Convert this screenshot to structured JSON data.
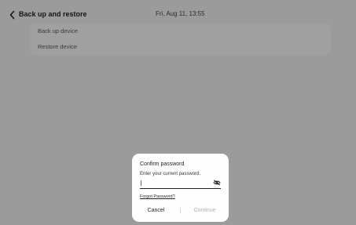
{
  "header": {
    "title": "Back up and restore",
    "datetime": "Fri, Aug 11, 13:55"
  },
  "menu": {
    "items": [
      {
        "label": "Back up device"
      },
      {
        "label": "Restore device"
      }
    ]
  },
  "dialog": {
    "title": "Confirm password",
    "subtitle": "Enter your current password.",
    "input_value": "",
    "forgot_label": "Forgot Password?",
    "cancel_label": "Cancel",
    "continue_label": "Continue"
  },
  "icons": {
    "back": "chevron-left-icon",
    "password_visibility": "eye-off-icon"
  },
  "colors": {
    "dim_background": "#9b9b9c",
    "dialog_background": "#fefefe",
    "continue_disabled": "#b1b1b1"
  }
}
